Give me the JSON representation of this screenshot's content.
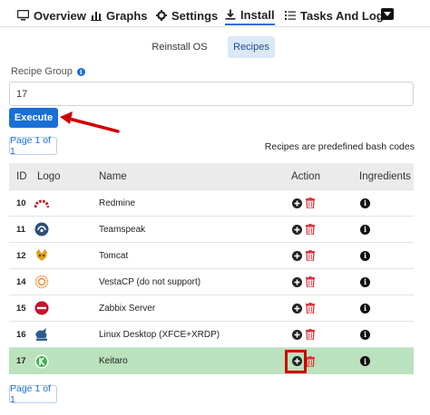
{
  "nav": {
    "tabs": [
      {
        "label": "Overview",
        "icon": "monitor-icon"
      },
      {
        "label": "Graphs",
        "icon": "bar-chart-icon"
      },
      {
        "label": "Settings",
        "icon": "gear-icon"
      },
      {
        "label": "Install",
        "icon": "download-icon"
      },
      {
        "label": "Tasks And Logs",
        "icon": "list-icon"
      }
    ],
    "active_tab": "Install"
  },
  "subtabs": [
    "Reinstall OS",
    "Recipes"
  ],
  "active_subtab": "Recipes",
  "form": {
    "recipe_group_label": "Recipe Group",
    "recipe_group_value": "17",
    "execute_label": "Execute"
  },
  "pagination": {
    "label": "Page 1 of 1"
  },
  "note": "Recipes are predefined bash codes",
  "table": {
    "headers": {
      "id": "ID",
      "logo": "Logo",
      "name": "Name",
      "action": "Action",
      "ingredients": "Ingredients"
    },
    "rows": [
      {
        "id": "10",
        "name": "Redmine",
        "logo": "redmine-logo"
      },
      {
        "id": "11",
        "name": "Teamspeak",
        "logo": "teamspeak-logo"
      },
      {
        "id": "12",
        "name": "Tomcat",
        "logo": "tomcat-logo"
      },
      {
        "id": "14",
        "name": "VestaCP (do not support)",
        "logo": "vestacp-logo"
      },
      {
        "id": "15",
        "name": "Zabbix Server",
        "logo": "zabbix-logo"
      },
      {
        "id": "16",
        "name": "Linux Desktop (XFCE+XRDP)",
        "logo": "xfce-logo"
      },
      {
        "id": "17",
        "name": "Keitaro",
        "logo": "keitaro-logo",
        "selected": true
      }
    ]
  },
  "colors": {
    "accent": "#1a6fd6",
    "selected_row": "#b9e2bd",
    "delete": "#d9363e",
    "annotation": "#d10000"
  }
}
